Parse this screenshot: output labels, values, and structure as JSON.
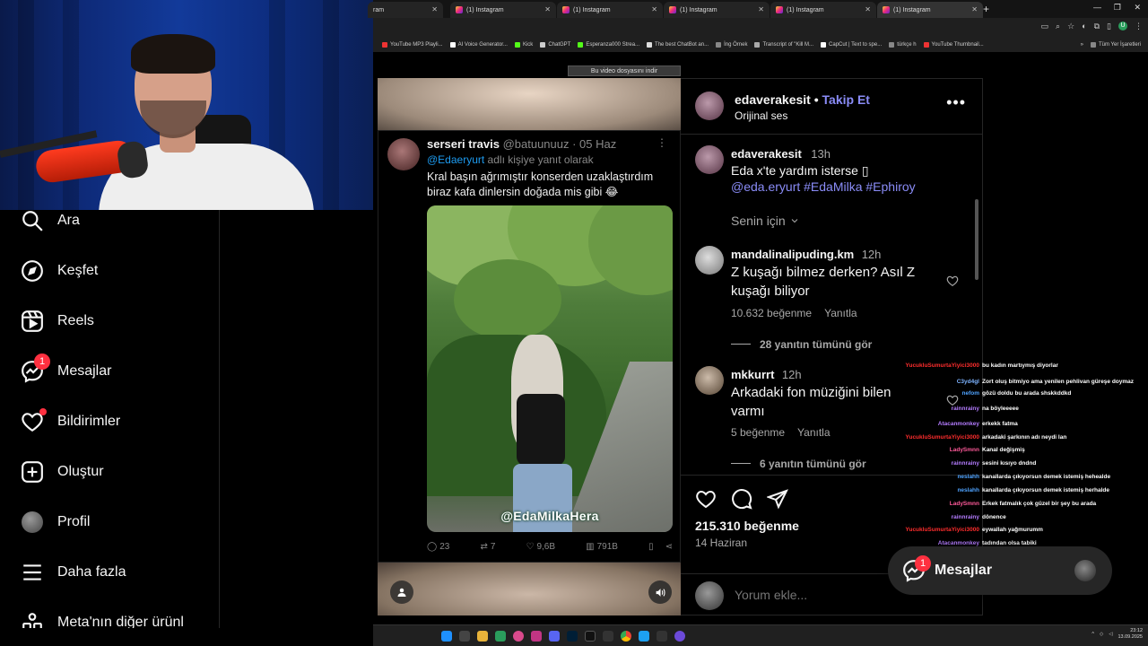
{
  "browser": {
    "tabs": [
      {
        "label": "(1) Instagram"
      },
      {
        "label": "(1) Instagram"
      },
      {
        "label": "(1) Instagram"
      },
      {
        "label": "(1) Instagram"
      },
      {
        "label": "(1) Instagram"
      },
      {
        "label": "(1) Instagram"
      }
    ],
    "first_tab_fragment": "ram",
    "bookmarks": [
      "YouTube MP3 Playli...",
      "AI Voice Generator...",
      "Kick",
      "ChatGPT",
      "Esperanza000 Strea...",
      "The best ChatBot an...",
      "İng Örnek",
      "Transcript of \"Kill M...",
      "CapCut | Text to spe...",
      "türkçe h",
      "YouTube Thumbnail..."
    ],
    "bookmarks_more": "»",
    "all_bookmarks": "Tüm Yer İşaretleri",
    "download_notice": "Bu video dosyasını indir"
  },
  "sidebar": {
    "items": [
      {
        "label": "Ara",
        "icon": "search-icon"
      },
      {
        "label": "Keşfet",
        "icon": "compass-icon"
      },
      {
        "label": "Reels",
        "icon": "reels-icon"
      },
      {
        "label": "Mesajlar",
        "icon": "messenger-icon",
        "badge": "1"
      },
      {
        "label": "Bildirimler",
        "icon": "heart-icon"
      },
      {
        "label": "Oluştur",
        "icon": "plus-square-icon"
      },
      {
        "label": "Profil",
        "icon": "avatar"
      },
      {
        "label": "Daha fazla",
        "icon": "menu-icon"
      },
      {
        "label": "Meta'nın diğer ürünl",
        "icon": "meta-icon"
      }
    ]
  },
  "tweet": {
    "name": "serseri travis",
    "handle": "@batuunuuz · 05 Haz",
    "reply_mention": "@Edaeryurt",
    "reply_suffix": " adlı kişiye yanıt olarak",
    "text": "Kral başın ağrımıştır konserden uzaklaştırdım biraz kafa dinlersin doğada mis gibi 😂",
    "photo_caption": "@EdaMilkaHera",
    "replies": "23",
    "retweets": "7",
    "likes": "9,6B",
    "views": "791B"
  },
  "post": {
    "username": "edaverakesit",
    "follow_label": "Takip Et",
    "audio": "Orijinal ses",
    "more": "•••",
    "caption": {
      "username": "edaverakesit",
      "time": "13h",
      "text": "Eda x'te yardım isterse ▯",
      "tags": "@eda.eryurt #EdaMilka #Ephiroy"
    },
    "sort_label": "Senin için",
    "comments": [
      {
        "username": "mandalinalipuding.km",
        "time": "12h",
        "text": "Z kuşağı bilmez derken? Asıl Z kuşağı biliyor",
        "likes": "10.632 beğenme",
        "reply": "Yanıtla",
        "view_replies": "28 yanıtın tümünü gör"
      },
      {
        "username": "mkkurrt",
        "time": "12h",
        "text": "Arkadaki fon müziğini bilen varmı",
        "likes": "5 beğenme",
        "reply": "Yanıtla",
        "view_replies": "6 yanıtın tümünü gör"
      }
    ],
    "like_count": "215.310 beğenme",
    "date": "14 Haziran",
    "comment_placeholder": "Yorum ekle..."
  },
  "chat": [
    {
      "user": "YucukluSumurtaYiyici3000",
      "color": "#ff2d2d",
      "msg": "bu kadın martıymış diyorlar"
    },
    {
      "user": "C3yd4gl",
      "color": "#7db3ff",
      "msg": "Zort oluş bitmiyo ama yenilen pehlivan güreşe doymaz"
    },
    {
      "user": "nefom",
      "color": "#4fa3ff",
      "msg": "gözü doldu bu arada shskkddkd"
    },
    {
      "user": "rainnrainy",
      "color": "#b47cff",
      "msg": "na böyleeeee"
    },
    {
      "user": "Atacanmonkey",
      "color": "#b47cff",
      "msg": "erkekk fatma"
    },
    {
      "user": "YucukluSumurtaYiyici3000",
      "color": "#ff2d2d",
      "msg": "arkadaki şarkının adı neydi lan"
    },
    {
      "user": "LadySmnn",
      "color": "#ff5a9a",
      "msg": "Kanal değişmiş"
    },
    {
      "user": "rainnrainy",
      "color": "#b47cff",
      "msg": "sesini kısıyo dndnd"
    },
    {
      "user": "neslahh",
      "color": "#4fa3ff",
      "msg": "kanallarda çıkıyorsun demek istemiş hehealde"
    },
    {
      "user": "neslahh",
      "color": "#4fa3ff",
      "msg": "kanallarda çıkıyorsun demek istemiş herhalde"
    },
    {
      "user": "LadySmnn",
      "color": "#ff5a9a",
      "msg": "Erkek fatmalık çok güzel bir şey bu arada"
    },
    {
      "user": "rainnrainy",
      "color": "#b47cff",
      "msg": "dönence"
    },
    {
      "user": "YucukluSumurtaYiyici3000",
      "color": "#ff2d2d",
      "msg": "eywallah yağmurumm"
    },
    {
      "user": "Atacanmonkey",
      "color": "#b47cff",
      "msg": "tadından olsa tabiki"
    }
  ],
  "messages_pill": {
    "label": "Mesajlar",
    "badge": "1"
  },
  "taskbar": {
    "time": "23:12",
    "date": "13.09.2025"
  }
}
